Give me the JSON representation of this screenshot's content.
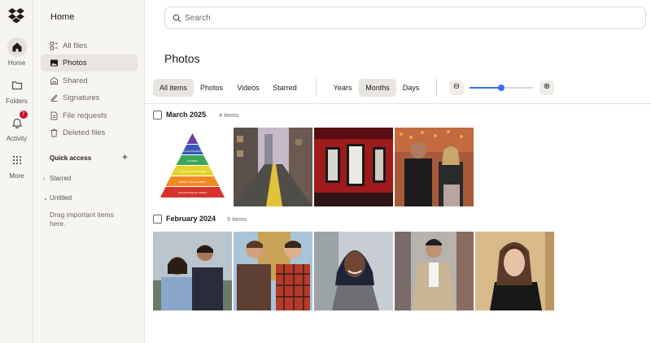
{
  "rail": {
    "items": [
      {
        "label": "Home",
        "icon": "home-icon"
      },
      {
        "label": "Folders",
        "icon": "folder-icon"
      },
      {
        "label": "Activity",
        "icon": "bell-icon",
        "badge": "7"
      },
      {
        "label": "More",
        "icon": "grid-icon"
      }
    ]
  },
  "sidebar": {
    "title": "Home",
    "items": [
      {
        "label": "All files",
        "icon": "files-icon"
      },
      {
        "label": "Photos",
        "icon": "photos-icon"
      },
      {
        "label": "Shared",
        "icon": "shared-icon"
      },
      {
        "label": "Signatures",
        "icon": "signature-icon"
      },
      {
        "label": "File requests",
        "icon": "file-request-icon"
      },
      {
        "label": "Deleted files",
        "icon": "trash-icon"
      }
    ],
    "quick_access": "Quick access",
    "starred": "Starred",
    "untitled": "Untitled",
    "hint": "Drag important items here."
  },
  "search": {
    "placeholder": "Search"
  },
  "page": {
    "title": "Photos"
  },
  "filters": {
    "type": [
      "All items",
      "Photos",
      "Videos",
      "Starred"
    ],
    "active_type": "All items",
    "granularity": [
      "Years",
      "Months",
      "Days"
    ],
    "active_granularity": "Months",
    "zoom_level": 0.5
  },
  "groups": [
    {
      "title": "March 2025",
      "count": "4 items"
    },
    {
      "title": "February 2024",
      "count": "5 items"
    }
  ],
  "pyramid": {
    "labels": [
      "SELF-ACTUALIZATION",
      "ESTEEM",
      "LOVE AND BELONGING",
      "SAFETY AND SECURITY",
      "PHYSIOLOGICAL NEEDS"
    ]
  },
  "colors": {
    "accent": "#3a6df0",
    "badge": "#c8102e",
    "sidebar_bg": "#f7f5f2"
  }
}
